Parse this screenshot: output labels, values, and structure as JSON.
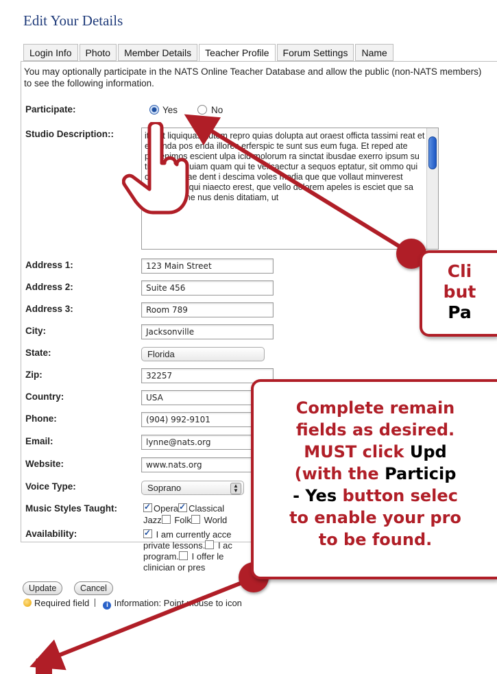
{
  "page": {
    "title": "Edit Your Details"
  },
  "tabs": [
    "Login Info",
    "Photo",
    "Member Details",
    "Teacher Profile",
    "Forum Settings",
    "Name"
  ],
  "active_tab": "Teacher Profile",
  "intro": "You may optionally participate in the NATS Online Teacher Database and allow the public (non-NATS members) to see the following information.",
  "participate": {
    "label": "Participate:",
    "yes": "Yes",
    "no": "No",
    "selected": "Yes"
  },
  "studio": {
    "label": "Studio Description::",
    "text": "itin et liquiquas autem repro quias dolupta aut oraest officta tassimi reat et eicianda pos enda illores erferspic te sunt sus eum fuga. Et reped ate prorenimos escient ulpa icid molorum ra sinctat ibusdae exerro ipsum su tia arum s quiam quam qui te velicaectur a sequos eptatur, sit ommo qui con nobisciae dent i descima voles modia que que vollaut minverest volent, utat qui niaecto erest, que vello dolorem apeles is esciet que sa quo essinime nus denis ditatiam, ut"
  },
  "fields": {
    "address1": {
      "label": "Address 1:",
      "value": "123 Main Street"
    },
    "address2": {
      "label": "Address 2:",
      "value": "Suite 456"
    },
    "address3": {
      "label": "Address 3:",
      "value": "Room 789"
    },
    "city": {
      "label": "City:",
      "value": "Jacksonville"
    },
    "state": {
      "label": "State:",
      "value": "Florida"
    },
    "zip": {
      "label": "Zip:",
      "value": "32257"
    },
    "country": {
      "label": "Country:",
      "value": "USA"
    },
    "phone": {
      "label": "Phone:",
      "value": "(904) 992-9101"
    },
    "email": {
      "label": "Email:",
      "value": "lynne@nats.org"
    },
    "website": {
      "label": "Website:",
      "value": "www.nats.org"
    },
    "voice": {
      "label": "Voice Type:",
      "value": "Soprano"
    }
  },
  "styles": {
    "label": "Music Styles Taught:",
    "opera": "Opera",
    "classical": "Classical",
    "jazz": "Jazz",
    "folk": "Folk",
    "world": "World"
  },
  "availability": {
    "label": "Availability:",
    "line1": "I am currently acce",
    "line2a": "private lessons.",
    "line2b": "I ac",
    "line3a": "program.",
    "line3b": "I offer le",
    "line4": "clinician or pres"
  },
  "buttons": {
    "update": "Update",
    "cancel": "Cancel"
  },
  "legend": {
    "required": "Required field",
    "info": "Information: Point mouse to icon"
  },
  "callout1": {
    "line1": "Cli",
    "line2": "but",
    "line3": "Pa"
  },
  "callout2": {
    "l1": "Complete remain",
    "l2": "fields as desired.",
    "l3a": "MUST click ",
    "l3b": "Upd",
    "l4a": "(with the ",
    "l4b": "Particip",
    "l5a": "- Yes",
    "l5b": " button selec",
    "l6": "to enable your pro",
    "l7": "to be found."
  },
  "colors": {
    "callout": "#b01e27",
    "title": "#1f3b7a",
    "background": "#e7d2d8"
  }
}
